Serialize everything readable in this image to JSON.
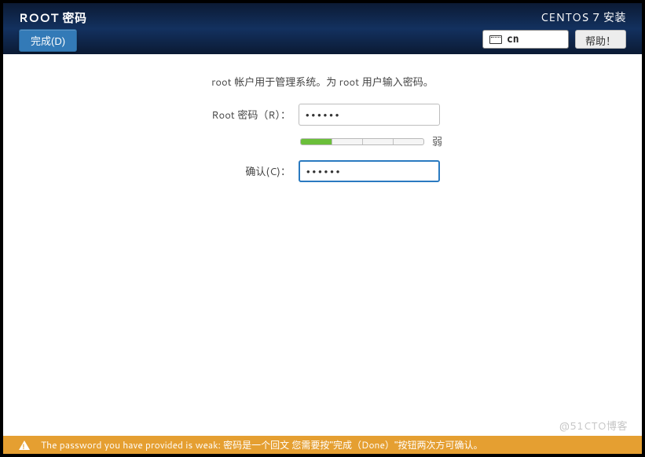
{
  "header": {
    "page_title": "ROOT 密码",
    "done_label": "完成(D)",
    "installer_title": "CENTOS 7 安装",
    "keyboard_layout": "cn",
    "help_label": "帮助！"
  },
  "form": {
    "description": "root 帐户用于管理系统。为 root 用户输入密码。",
    "password_label": "Root 密码（R）：",
    "password_value": "••••••",
    "confirm_label": "确认(C)：",
    "confirm_value": "••••••",
    "strength_text": "弱",
    "strength_fill_percent": 25
  },
  "warning": {
    "message": "The password you have provided is weak: 密码是一个回文 您需要按\"完成（Done）\"按钮两次方可确认。"
  },
  "watermark": "@51CTO博客"
}
